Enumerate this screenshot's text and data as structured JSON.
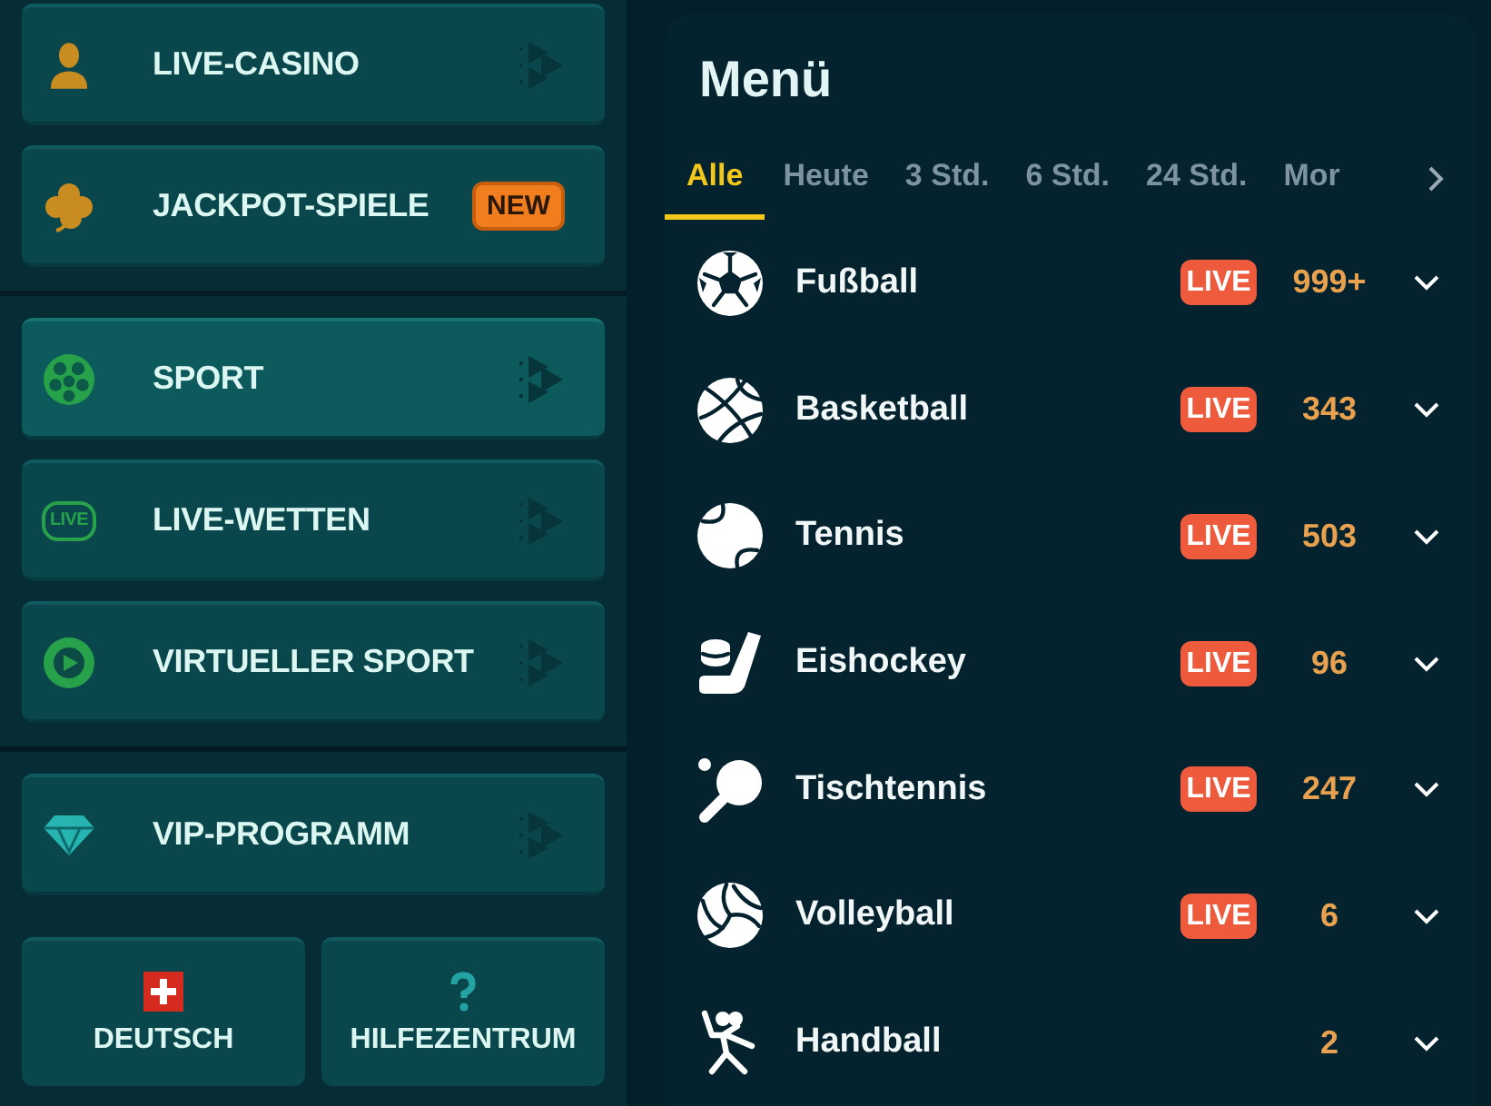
{
  "sidebar": {
    "groups": [
      {
        "items": [
          {
            "label": "LIVE-CASINO",
            "selected": false
          },
          {
            "label": "JACKPOT-SPIELE",
            "selected": false,
            "badge": "NEW"
          }
        ]
      },
      {
        "items": [
          {
            "label": "SPORT",
            "selected": true
          },
          {
            "label": "LIVE-WETTEN",
            "selected": false,
            "icon_text": "LIVE"
          },
          {
            "label": "VIRTUELLER SPORT",
            "selected": false
          }
        ]
      },
      {
        "items": [
          {
            "label": "VIP-PROGRAMM",
            "selected": false
          }
        ]
      }
    ],
    "footer_buttons": [
      {
        "label": "DEUTSCH"
      },
      {
        "label": "HILFEZENTRUM"
      }
    ]
  },
  "menu": {
    "title": "Menü",
    "tabs": [
      {
        "label": "Alle",
        "selected": true
      },
      {
        "label": "Heute",
        "selected": false
      },
      {
        "label": "3 Std.",
        "selected": false
      },
      {
        "label": "6 Std.",
        "selected": false
      },
      {
        "label": "24 Std.",
        "selected": false
      },
      {
        "label": "Mor",
        "selected": false
      }
    ],
    "sports": [
      {
        "name": "Fußball",
        "badge": "LIVE",
        "count": "999+"
      },
      {
        "name": "Basketball",
        "badge": "LIVE",
        "count": "343"
      },
      {
        "name": "Tennis",
        "badge": "LIVE",
        "count": "503"
      },
      {
        "name": "Eishockey",
        "badge": "LIVE",
        "count": "96"
      },
      {
        "name": "Tischtennis",
        "badge": "LIVE",
        "count": "247"
      },
      {
        "name": "Volleyball",
        "badge": "LIVE",
        "count": "6"
      },
      {
        "name": "Handball",
        "count": "2"
      }
    ]
  }
}
